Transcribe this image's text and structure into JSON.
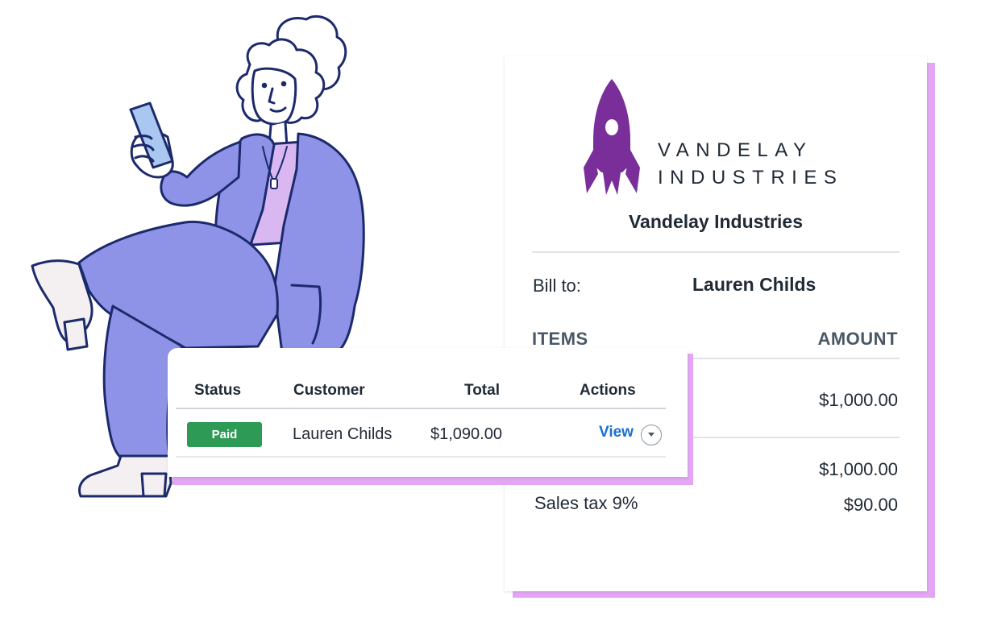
{
  "invoice": {
    "logo_line1": "VANDELAY",
    "logo_line2": "INDUSTRIES",
    "company_name": "Vandelay Industries",
    "bill_to_label": "Bill to:",
    "bill_to_name": "Lauren Childs",
    "items_header": "ITEMS",
    "amount_header": "AMOUNT",
    "item_amount": "$1,000.00",
    "subtotal_amount": "$1,000.00",
    "tax_label": "Sales tax 9%",
    "tax_amount": "$90.00",
    "brand_color": "#7a2e9a"
  },
  "table": {
    "headers": {
      "status": "Status",
      "customer": "Customer",
      "total": "Total",
      "actions": "Actions"
    },
    "rows": [
      {
        "status": "Paid",
        "customer": "Lauren Childs",
        "total": "$1,090.00",
        "action": "View"
      }
    ],
    "status_color": "#2d9a56",
    "link_color": "#1b6fd1"
  },
  "colors": {
    "accent_shadow": "#e3a5f4",
    "suit": "#8f93e8",
    "top": "#d9b8f2",
    "outline": "#1c2a6b"
  }
}
